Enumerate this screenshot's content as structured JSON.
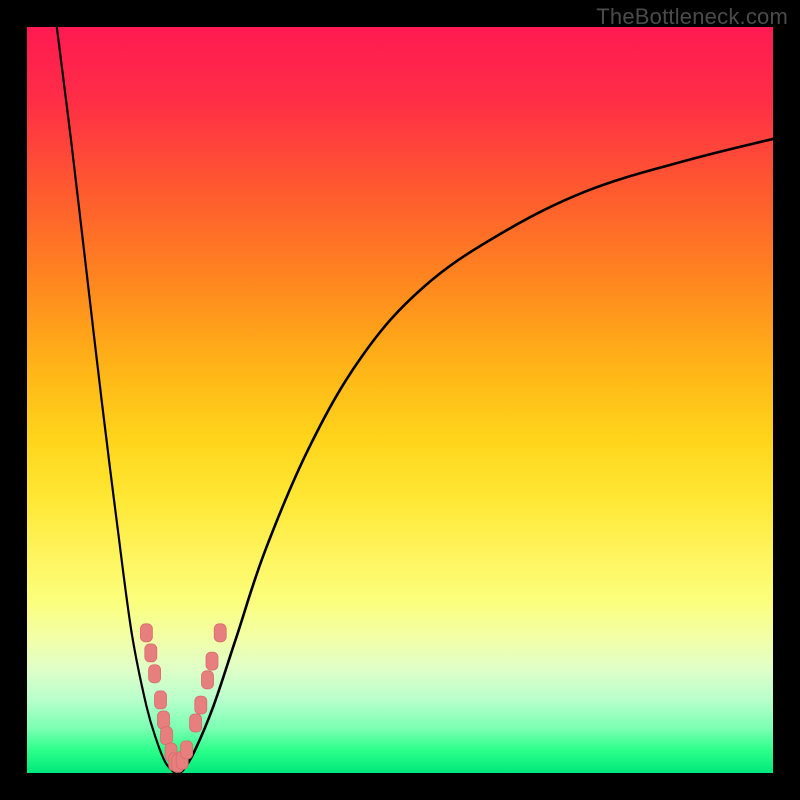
{
  "watermark": "TheBottleneck.com",
  "colors": {
    "frame": "#000000",
    "curve": "#000000",
    "marker": "#e77f7f"
  },
  "chart_data": {
    "type": "line",
    "title": "",
    "xlabel": "",
    "ylabel": "",
    "xlim": [
      0,
      100
    ],
    "ylim": [
      0,
      100
    ],
    "grid": false,
    "note": "Axes unlabeled; x expressed as 0–100 left→right, y as 0 (bottom, green) → 100 (top, red). Values estimated from pixel positions.",
    "series": [
      {
        "name": "left-branch",
        "x": [
          4,
          6,
          8,
          10,
          12,
          14,
          16,
          17.5,
          18.5,
          19.3,
          19.8
        ],
        "y": [
          100,
          84,
          67,
          50,
          34,
          19,
          9,
          4,
          1.5,
          0.5,
          0
        ]
      },
      {
        "name": "right-branch",
        "x": [
          20.2,
          21,
          22.5,
          25,
          28,
          32,
          38,
          45,
          53,
          63,
          75,
          88,
          100
        ],
        "y": [
          0,
          0.5,
          3,
          9,
          18,
          30,
          44,
          56,
          65,
          72,
          78,
          82,
          85
        ]
      }
    ],
    "markers": {
      "name": "highlighted-points",
      "points": [
        {
          "x": 16.0,
          "y": 18.8
        },
        {
          "x": 16.6,
          "y": 16.1
        },
        {
          "x": 17.1,
          "y": 13.3
        },
        {
          "x": 17.9,
          "y": 9.8
        },
        {
          "x": 18.3,
          "y": 7.1
        },
        {
          "x": 18.7,
          "y": 5.0
        },
        {
          "x": 19.3,
          "y": 2.8
        },
        {
          "x": 19.8,
          "y": 1.5
        },
        {
          "x": 20.2,
          "y": 1.3
        },
        {
          "x": 20.8,
          "y": 1.7
        },
        {
          "x": 21.4,
          "y": 3.1
        },
        {
          "x": 22.6,
          "y": 6.7
        },
        {
          "x": 23.3,
          "y": 9.1
        },
        {
          "x": 24.2,
          "y": 12.5
        },
        {
          "x": 24.8,
          "y": 15.0
        },
        {
          "x": 25.9,
          "y": 18.8
        }
      ]
    }
  }
}
